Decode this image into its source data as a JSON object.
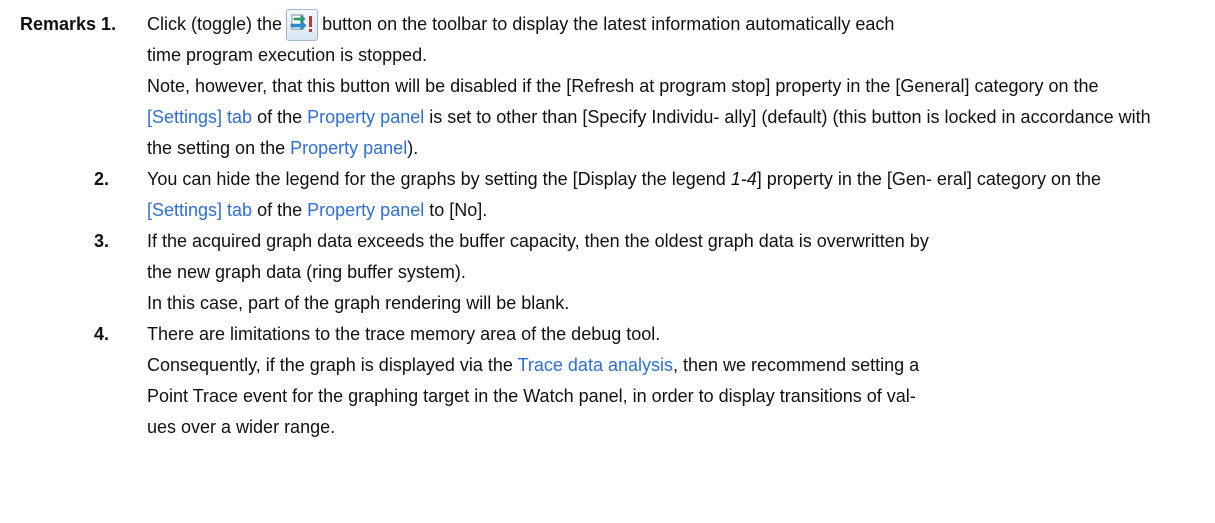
{
  "remarks_label": "Remarks 1.",
  "remark1": {
    "line1_before_icon": "Click (toggle) the",
    "line1_after_icon": "button on the toolbar to display the latest information automatically each",
    "line2": "time program execution is stopped.",
    "p2_a": "Note, however, that this button will be disabled if the [Refresh at program stop] property in the",
    "p2_b": "[General] category on the",
    "p2_link_settings_tab": "[Settings] tab",
    "p2_c": "of the",
    "p2_link_property_panel": "Property panel",
    "p2_d": "is set to other than [Specify Individu-",
    "p2_e": "ally] (default) (this button is locked in accordance with the setting on the",
    "p2_link_property_panel_2": "Property panel",
    "p2_f": ").",
    "icon": "refresh-at-stop-icon"
  },
  "remark2": {
    "num": "2.",
    "a": "You can hide the legend for the graphs by setting the [Display the legend",
    "italic": "1-4",
    "b": "] property in the [Gen-",
    "c": "eral] category on the",
    "link_settings_tab": "[Settings] tab",
    "d": "of the",
    "link_property_panel": "Property panel",
    "e": "to [No]."
  },
  "remark3": {
    "num": "3.",
    "line1": "If the acquired graph data exceeds the buffer capacity, then the oldest graph data is overwritten by",
    "line2": "the new graph data (ring buffer system).",
    "line3": "In this case, part of the graph rendering will be blank."
  },
  "remark4": {
    "num": "4.",
    "line1": "There are limitations to the trace memory area of the debug tool.",
    "a": "Consequently, if the graph is displayed via the",
    "link_trace": "Trace data analysis",
    "b": ", then we recommend setting a",
    "line3": "Point Trace event for the graphing target in the Watch panel, in order to display transitions of val-",
    "line4": "ues over a wider range."
  },
  "colors": {
    "link": "#2f6fd8",
    "text": "#111111"
  }
}
